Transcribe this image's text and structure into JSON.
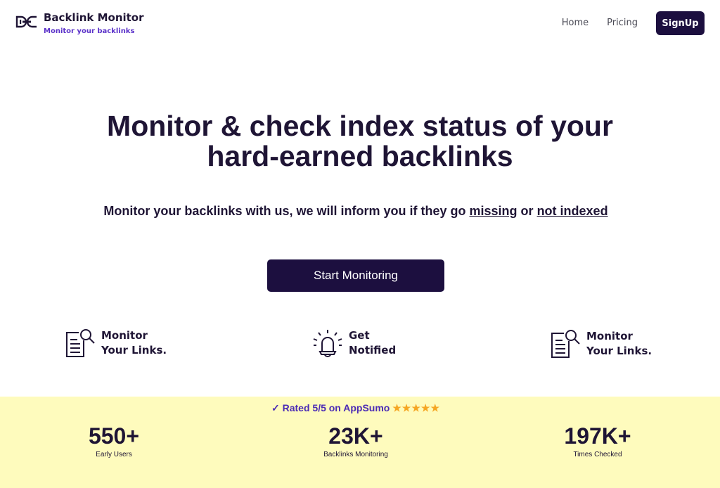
{
  "brand": {
    "name": "Backlink Monitor",
    "tagline": "Monitor your backlinks",
    "logo_icon": "link-chain-icon"
  },
  "nav": {
    "home": "Home",
    "pricing": "Pricing",
    "signup": "SignUp"
  },
  "hero": {
    "title_line1": "Monitor & check index status of your",
    "title_line2": "hard-earned backlinks",
    "subtitle_pre": "Monitor your backlinks with us, we will inform you if they go",
    "subtitle_missing": "missing",
    "subtitle_or": "or",
    "subtitle_not_indexed": "not indexed",
    "cta": "Start Monitoring"
  },
  "features": [
    {
      "line1": "Monitor",
      "line2": "Your Links.",
      "icon": "document-search-icon"
    },
    {
      "line1": "Get",
      "line2": "Notified",
      "icon": "bell-icon"
    },
    {
      "line1": "Monitor",
      "line2": "Your Links.",
      "icon": "document-search-icon"
    }
  ],
  "stats": {
    "rating_text": "✓ Rated 5/5 on AppSumo",
    "rating_stars": "★★★★★",
    "items": [
      {
        "value": "550+",
        "label": "Early Users"
      },
      {
        "value": "23K+",
        "label": "Backlinks Monitoring"
      },
      {
        "value": "197K+",
        "label": "Times Checked"
      }
    ]
  },
  "colors": {
    "primary_dark": "#1c0f3f",
    "accent_purple": "#5b32c9",
    "band_yellow": "#fefbbd",
    "star_orange": "#f5a623"
  }
}
